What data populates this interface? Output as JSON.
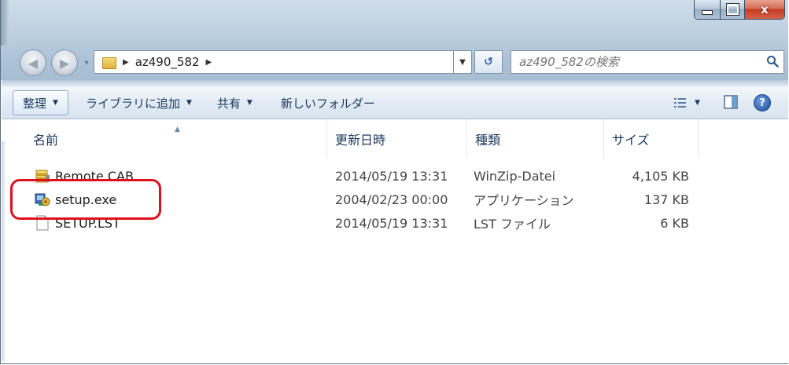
{
  "window": {
    "address": {
      "crumbs": [
        "az490_582"
      ],
      "search_placeholder": "az490_582の検索"
    },
    "caption": {
      "close_label": "x"
    }
  },
  "toolbar": {
    "organize": "整理",
    "add_to_library": "ライブラリに追加",
    "share": "共有",
    "new_folder": "新しいフォルダー",
    "help": "?"
  },
  "columns": {
    "name": "名前",
    "date": "更新日時",
    "type": "種類",
    "size": "サイズ"
  },
  "files": [
    {
      "name": "Remote.CAB",
      "date": "2014/05/19 13:31",
      "type": "WinZip-Datei",
      "size": "4,105 KB",
      "icon": "archive-icon"
    },
    {
      "name": "setup.exe",
      "date": "2004/02/23 00:00",
      "type": "アプリケーション",
      "size": "137 KB",
      "icon": "setup-exe-icon"
    },
    {
      "name": "SETUP.LST",
      "date": "2014/05/19 13:31",
      "type": "LST ファイル",
      "size": "6 KB",
      "icon": "blank-file-icon"
    }
  ],
  "colors": {
    "highlight": "#e0101a",
    "close_button": "#c43b22",
    "toolbar_text": "#1e3a5c"
  }
}
